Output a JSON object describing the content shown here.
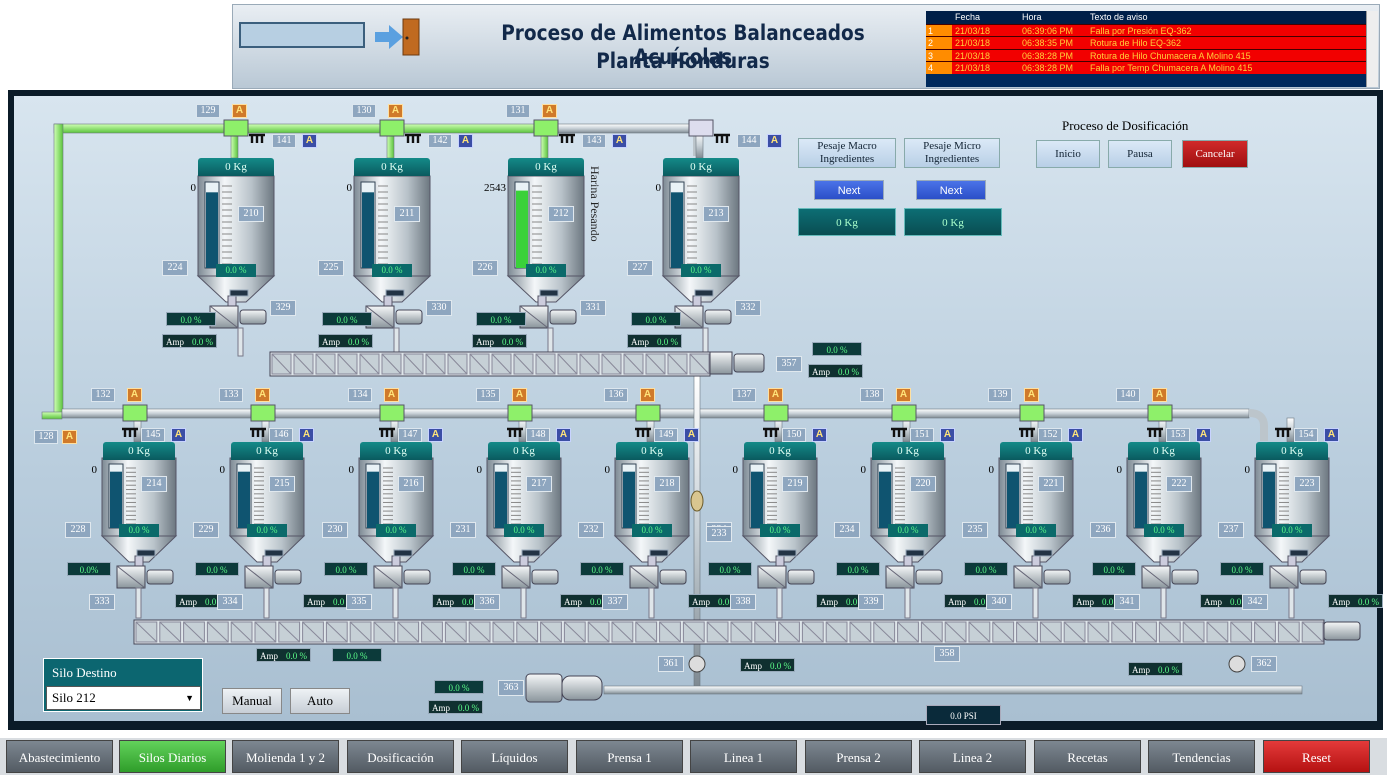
{
  "header": {
    "title1": "Proceso de Alimentos Balanceados Acuícolas",
    "title2": "Planta Honduras"
  },
  "alarms": {
    "headers": [
      "",
      "Fecha",
      "Hora",
      "Texto de aviso"
    ],
    "rows": [
      [
        "1",
        "21/03/18",
        "06:39:06 PM",
        "Falla por Presión EQ-362"
      ],
      [
        "2",
        "21/03/18",
        "06:38:35 PM",
        "Rotura de Hilo EQ-362"
      ],
      [
        "3",
        "21/03/18",
        "06:38:28 PM",
        "Rotura de Hilo Chumacera A Molino 415"
      ],
      [
        "4",
        "21/03/18",
        "06:38:28 PM",
        "Falla por Temp Chumacera A Molino 415"
      ]
    ]
  },
  "top_silos": [
    {
      "silo": "210",
      "inlet": "129",
      "valve": "141",
      "kg": "0 Kg",
      "level": "0",
      "scale": "224",
      "pct": "0.0 %",
      "feeder": "329",
      "feeder_pct": "0.0 %",
      "amp": "0.0 %",
      "fill": 0.0
    },
    {
      "silo": "211",
      "inlet": "130",
      "valve": "142",
      "kg": "0 Kg",
      "level": "0",
      "scale": "225",
      "pct": "0.0 %",
      "feeder": "330",
      "feeder_pct": "0.0 %",
      "amp": "0.0 %",
      "fill": 0.0
    },
    {
      "silo": "212",
      "inlet": "131",
      "valve": "143",
      "kg": "0 Kg",
      "level": "2543",
      "scale": "226",
      "pct": "0.0 %",
      "feeder": "331",
      "feeder_pct": "0.0 %",
      "amp": "0.0 %",
      "fill": 0.9
    },
    {
      "silo": "213",
      "inlet": "",
      "valve": "144",
      "kg": "0 Kg",
      "level": "0",
      "scale": "227",
      "pct": "0.0 %",
      "feeder": "332",
      "feeder_pct": "0.0 %",
      "amp": "0.0 %",
      "fill": 0.0
    }
  ],
  "vertical_label": "Harina Pesando",
  "conveyor_top": {
    "id": "357",
    "pct": "0.0 %",
    "amp": "0.0 %"
  },
  "bottom_silos": [
    {
      "silo": "214",
      "inlet": "132",
      "valve": "145",
      "kg": "0 Kg",
      "level": "0",
      "scale": "228",
      "pct": "0.0 %",
      "feeder": "333",
      "feeder_pct": "0.0%",
      "amp": "0.0 %"
    },
    {
      "silo": "215",
      "inlet": "133",
      "valve": "146",
      "kg": "0 Kg",
      "level": "0",
      "scale": "229",
      "pct": "0.0 %",
      "feeder": "334",
      "feeder_pct": "0.0 %",
      "amp": "0.0 %"
    },
    {
      "silo": "216",
      "inlet": "134",
      "valve": "147",
      "kg": "0 Kg",
      "level": "0",
      "scale": "230",
      "pct": "0.0 %",
      "feeder": "335",
      "feeder_pct": "0.0 %",
      "amp": "0.0 %"
    },
    {
      "silo": "217",
      "inlet": "135",
      "valve": "148",
      "kg": "0 Kg",
      "level": "0",
      "scale": "231",
      "pct": "0.0 %",
      "feeder": "336",
      "feeder_pct": "0.0 %",
      "amp": "0.0 %"
    },
    {
      "silo": "218",
      "inlet": "136",
      "valve": "149",
      "kg": "0 Kg",
      "level": "0",
      "scale": "232",
      "pct": "0.0 %",
      "feeder": "337",
      "feeder_pct": "0.0 %",
      "amp": "0.0 %"
    },
    {
      "silo": "219",
      "inlet": "137",
      "valve": "150",
      "kg": "0 Kg",
      "level": "0",
      "scale": "234",
      "pct": "0.0 %",
      "feeder": "338",
      "feeder_pct": "0.0 %",
      "amp": "0.0 %"
    },
    {
      "silo": "220",
      "inlet": "138",
      "valve": "151",
      "kg": "0 Kg",
      "level": "0",
      "scale": "234",
      "pct": "0.0 %",
      "feeder": "339",
      "feeder_pct": "0.0 %",
      "amp": "0.0 %"
    },
    {
      "silo": "221",
      "inlet": "139",
      "valve": "152",
      "kg": "0 Kg",
      "level": "0",
      "scale": "235",
      "pct": "0.0 %",
      "feeder": "340",
      "feeder_pct": "0.0 %",
      "amp": "0.0 %"
    },
    {
      "silo": "222",
      "inlet": "140",
      "valve": "153",
      "kg": "0 Kg",
      "level": "0",
      "scale": "236",
      "pct": "0.0 %",
      "feeder": "341",
      "feeder_pct": "0.0 %",
      "amp": "0.0 %"
    },
    {
      "silo": "223",
      "inlet": "",
      "valve": "154",
      "kg": "0 Kg",
      "level": "0",
      "scale": "237",
      "pct": "0.0 %",
      "feeder": "342",
      "feeder_pct": "0.0 %",
      "amp": "0.0 %"
    }
  ],
  "misc": {
    "main_inlet": "128",
    "sensor_233": "233",
    "conveyor_358": "358",
    "valve_361": "361",
    "valve_362": "362",
    "pump_363": "363",
    "psi": "0.0 PSI",
    "amp_bottom_left": "0.0 %",
    "pct_bottom_left": "0.0 %",
    "amp_358": "0.0 %",
    "amp_362": "0.0 %",
    "pump_pct": "0.0 %",
    "pump_amp": "0.0 %"
  },
  "dosing": {
    "macro_label": "Pesaje Macro Ingredientes",
    "micro_label": "Pesaje Micro Ingredientes",
    "next": "Next",
    "macro_kg": "0 Kg",
    "micro_kg": "0 Kg",
    "title": "Proceso de Dosificación",
    "inicio": "Inicio",
    "pausa": "Pausa",
    "cancelar": "Cancelar"
  },
  "silo_destino": {
    "label": "Silo Destino",
    "value": "Silo 212"
  },
  "mode": {
    "manual": "Manual",
    "auto": "Auto"
  },
  "amp_label": "Amp",
  "nav": [
    {
      "label": "Abastecimiento"
    },
    {
      "label": "Silos Diarios",
      "active": true
    },
    {
      "label": "Molienda 1 y 2"
    },
    {
      "label": "Dosificación"
    },
    {
      "label": "Líquidos"
    },
    {
      "label": "Prensa 1"
    },
    {
      "label": "Linea 1"
    },
    {
      "label": "Prensa 2"
    },
    {
      "label": "Linea 2"
    },
    {
      "label": "Recetas"
    },
    {
      "label": "Tendencias"
    },
    {
      "label": "Reset"
    }
  ],
  "colors": {
    "active_pipe": "#8ef06a",
    "pipe": "#e8edf0",
    "screen": "#c3d5e3",
    "active_tab": "#3fb538",
    "reset": "#d02020"
  }
}
